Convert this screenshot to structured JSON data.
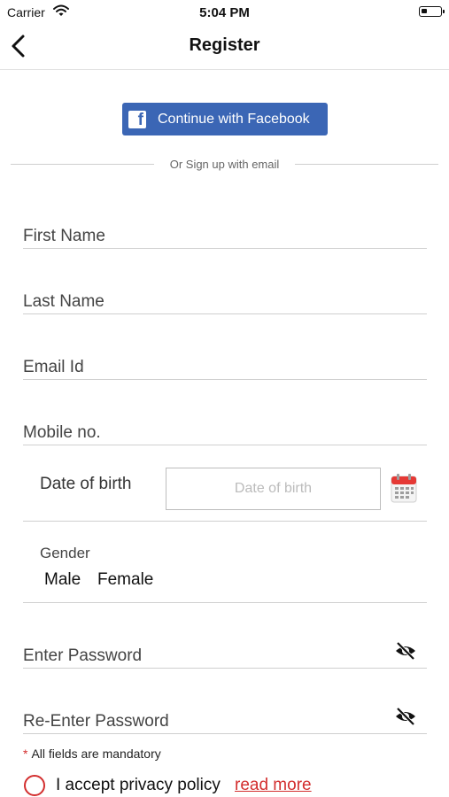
{
  "status_bar": {
    "carrier": "Carrier",
    "time": "5:04 PM"
  },
  "nav": {
    "title": "Register"
  },
  "facebook": {
    "label": "Continue with Facebook"
  },
  "divider": {
    "text": "Or Sign up with email"
  },
  "fields": {
    "first_name": "First Name",
    "last_name": "Last Name",
    "email": "Email Id",
    "mobile": "Mobile no.",
    "password": "Enter Password",
    "re_password": "Re-Enter Password"
  },
  "dob": {
    "label": "Date of birth",
    "placeholder": "Date of birth"
  },
  "gender": {
    "label": "Gender",
    "options": [
      "Male",
      "Female"
    ]
  },
  "mandatory": {
    "star": "*",
    "text": "All fields are mandatory"
  },
  "privacy": {
    "text": "I accept privacy policy",
    "link": "read more"
  },
  "colors": {
    "facebook": "#3b66b5",
    "accent_red": "#d32f2f"
  },
  "icons": [
    "wifi-icon",
    "battery-icon",
    "back-chevron-icon",
    "facebook-icon",
    "calendar-icon",
    "eye-off-icon",
    "radio-unchecked-icon"
  ]
}
